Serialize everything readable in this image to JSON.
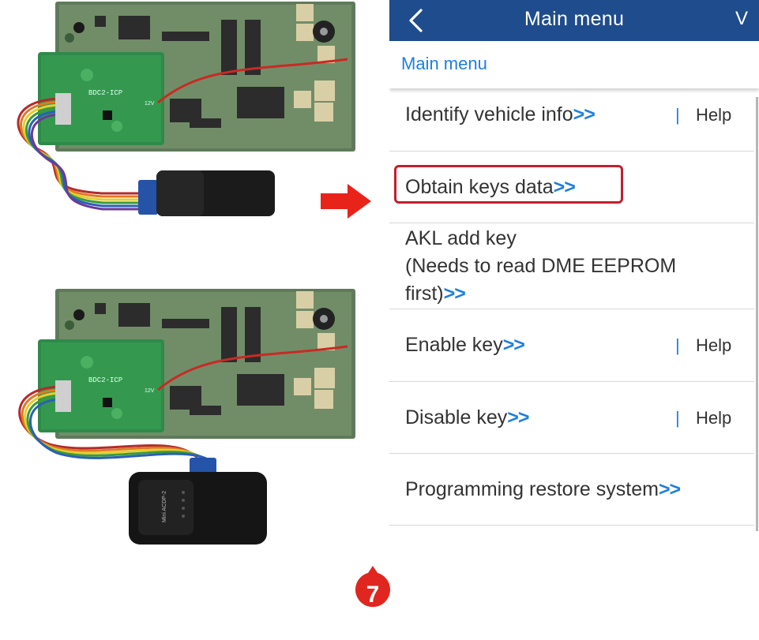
{
  "screen": {
    "title": "Main menu",
    "title_suffix": "V",
    "breadcrumb": "Main menu"
  },
  "menu": {
    "items": [
      {
        "label": "Identify vehicle info",
        "arrows": ">>",
        "help_sep": "|",
        "help": "Help"
      },
      {
        "label": "Obtain keys data",
        "arrows": ">>",
        "highlighted": true
      },
      {
        "label_line1": "AKL add key",
        "label_line2": "(Needs to read DME EEPROM",
        "label_line3": "first)",
        "arrows": ">>"
      },
      {
        "label": "Enable key",
        "arrows": ">>",
        "help_sep": "|",
        "help": "Help"
      },
      {
        "label": "Disable key",
        "arrows": ">>",
        "help_sep": "|",
        "help": "Help"
      },
      {
        "label": "Programming restore system",
        "arrows": ">>"
      }
    ]
  },
  "step": {
    "number": "7"
  },
  "boards": {
    "board_label_top": "BDC2-ICP",
    "board_label_bottom": "BDC2-ICP",
    "volt_label": "12V",
    "device_label": "Mini ACDP-2"
  },
  "colors": {
    "titlebar": "#1f4c8c",
    "link_blue": "#1e7fe0",
    "highlight_red": "#c31e2e",
    "pcb_green": "#2f8a4a",
    "arrow_red": "#e8231a"
  }
}
